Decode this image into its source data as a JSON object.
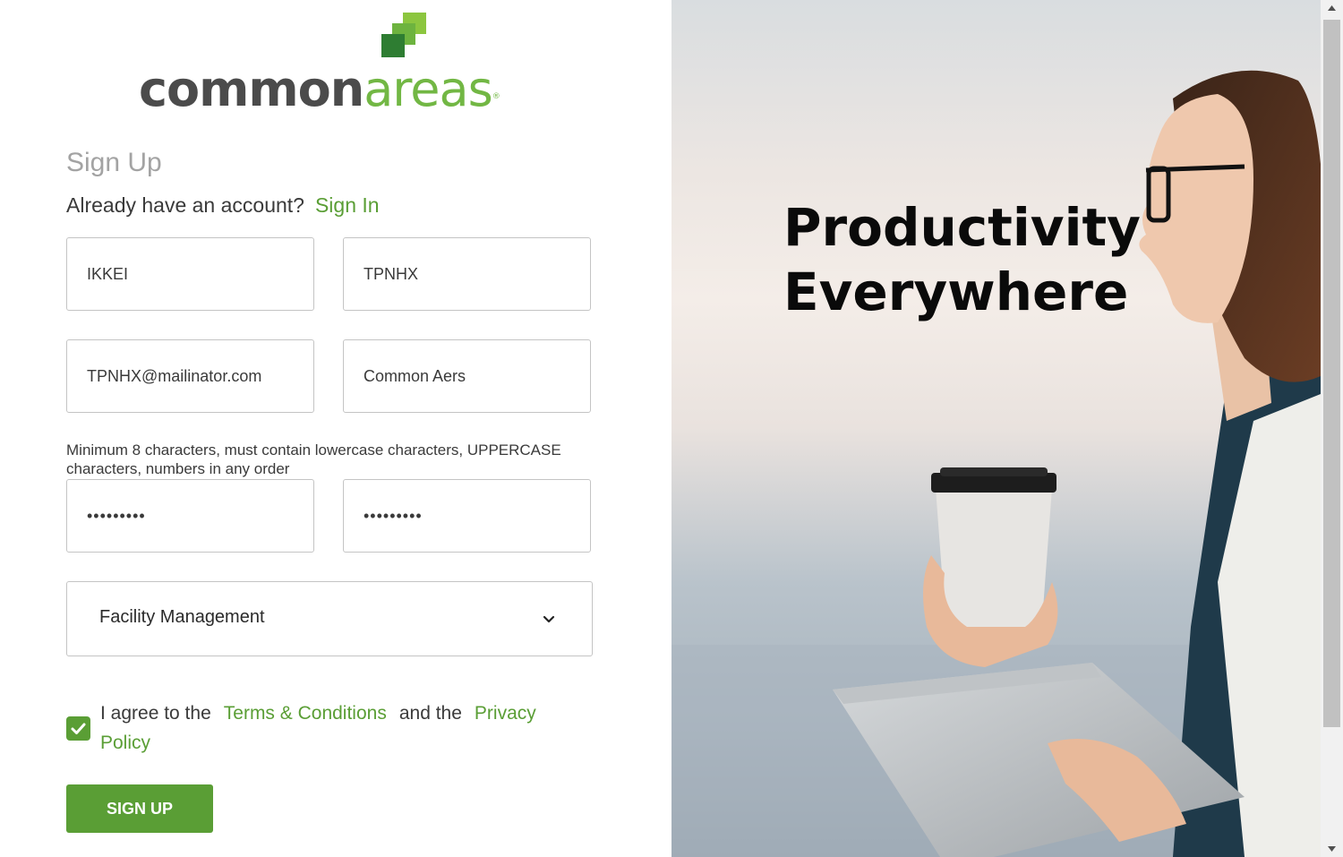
{
  "brand": {
    "name_part1": "common",
    "name_part2": "areas",
    "trademark": "®",
    "primary_color": "#5a9e35",
    "logo_dark_color": "#4b4b4b"
  },
  "form": {
    "title": "Sign Up",
    "have_account_text": "Already have an account?",
    "sign_in_label": "Sign In",
    "first_name_value": "IKKEI",
    "last_name_value": "TPNHX",
    "email_value": "TPNHX@mailinator.com",
    "company_value": "Common Aers",
    "password_hint": "Minimum 8 characters, must contain lowercase characters, UPPERCASE characters, numbers in any order",
    "password_value": "•••••••••",
    "confirm_password_value": "•••••••••",
    "industry_selected": "Facility Management",
    "agree_prefix": "I agree to the",
    "terms_label": "Terms & Conditions",
    "agree_middle": "and the",
    "privacy_label": "Privacy Policy",
    "agree_checked": true,
    "submit_label": "SIGN UP"
  },
  "hero": {
    "headline_line1": "Productivity",
    "headline_line2": "Everywhere"
  },
  "icons": {
    "checkbox": "check-icon",
    "select": "chevron-down-icon",
    "scroll_up": "scroll-up-arrow-icon",
    "scroll_down": "scroll-down-arrow-icon"
  }
}
